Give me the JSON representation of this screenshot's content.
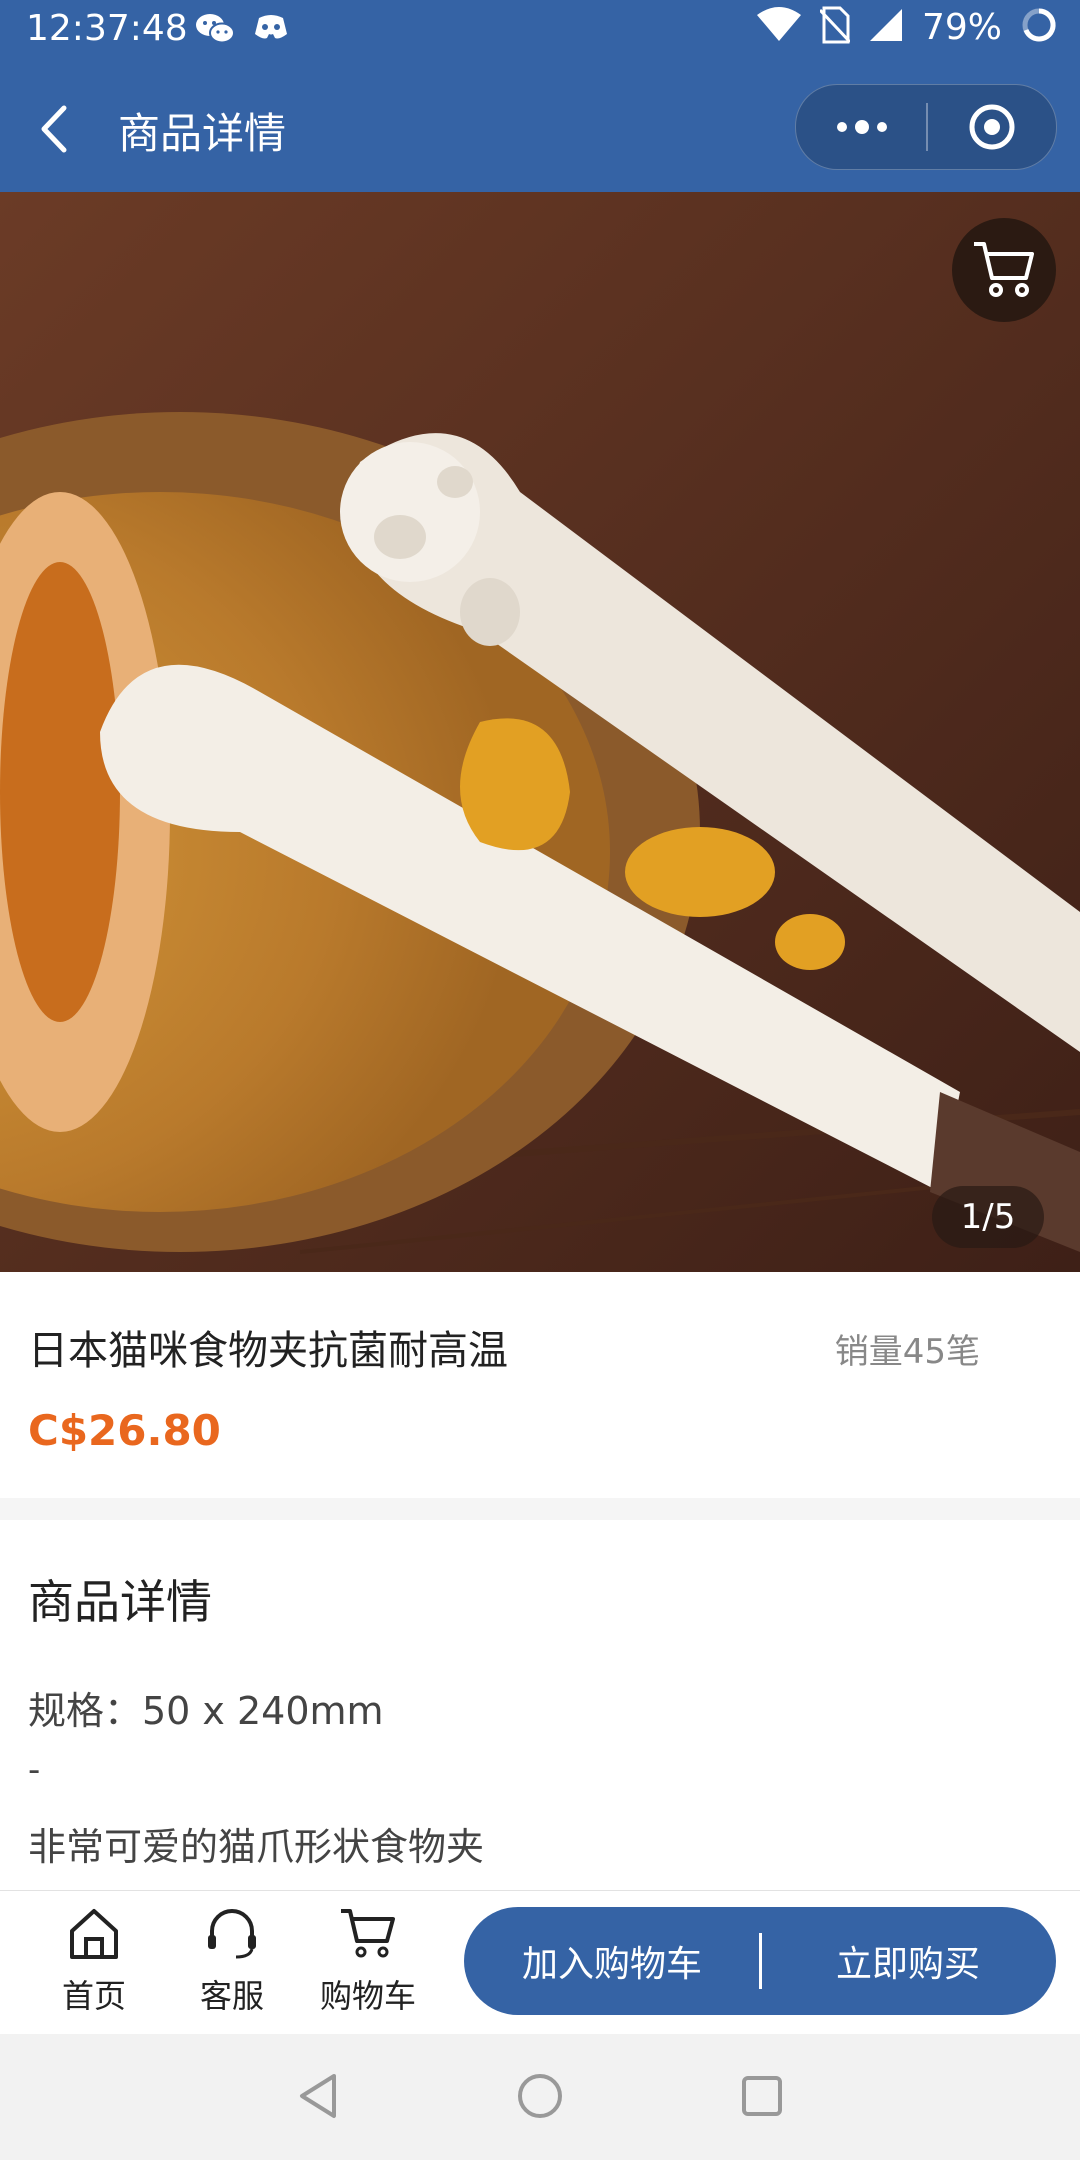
{
  "status_bar": {
    "time": "12:37:48",
    "battery": "79%",
    "icons": [
      "wechat-icon",
      "discord-icon",
      "wifi-icon",
      "no-sim-icon",
      "signal-icon",
      "loading-ring-icon"
    ]
  },
  "nav": {
    "title": "商品详情",
    "back_icon": "chevron-left-icon",
    "capsule_icons": [
      "more-dots-icon",
      "target-icon"
    ]
  },
  "gallery": {
    "pager": "1/5",
    "image_description": "cat-paw food tongs on wooden plate",
    "cart_icon": "cart-icon"
  },
  "product": {
    "title": "日本猫咪食物夹抗菌耐高温",
    "sales": "销量45笔",
    "price": "C$26.80"
  },
  "details": {
    "title": "商品详情",
    "spec": "规格：50 x 240mm",
    "dash": "-",
    "description": "非常可爱的猫爪形状食物夹"
  },
  "bottom_bar": {
    "home_label": "首页",
    "service_label": "客服",
    "cart_label": "购物车",
    "add_to_cart": "加入购物车",
    "buy_now": "立即购买"
  },
  "colors": {
    "primary": "#3563a5",
    "price": "#e9671e"
  }
}
